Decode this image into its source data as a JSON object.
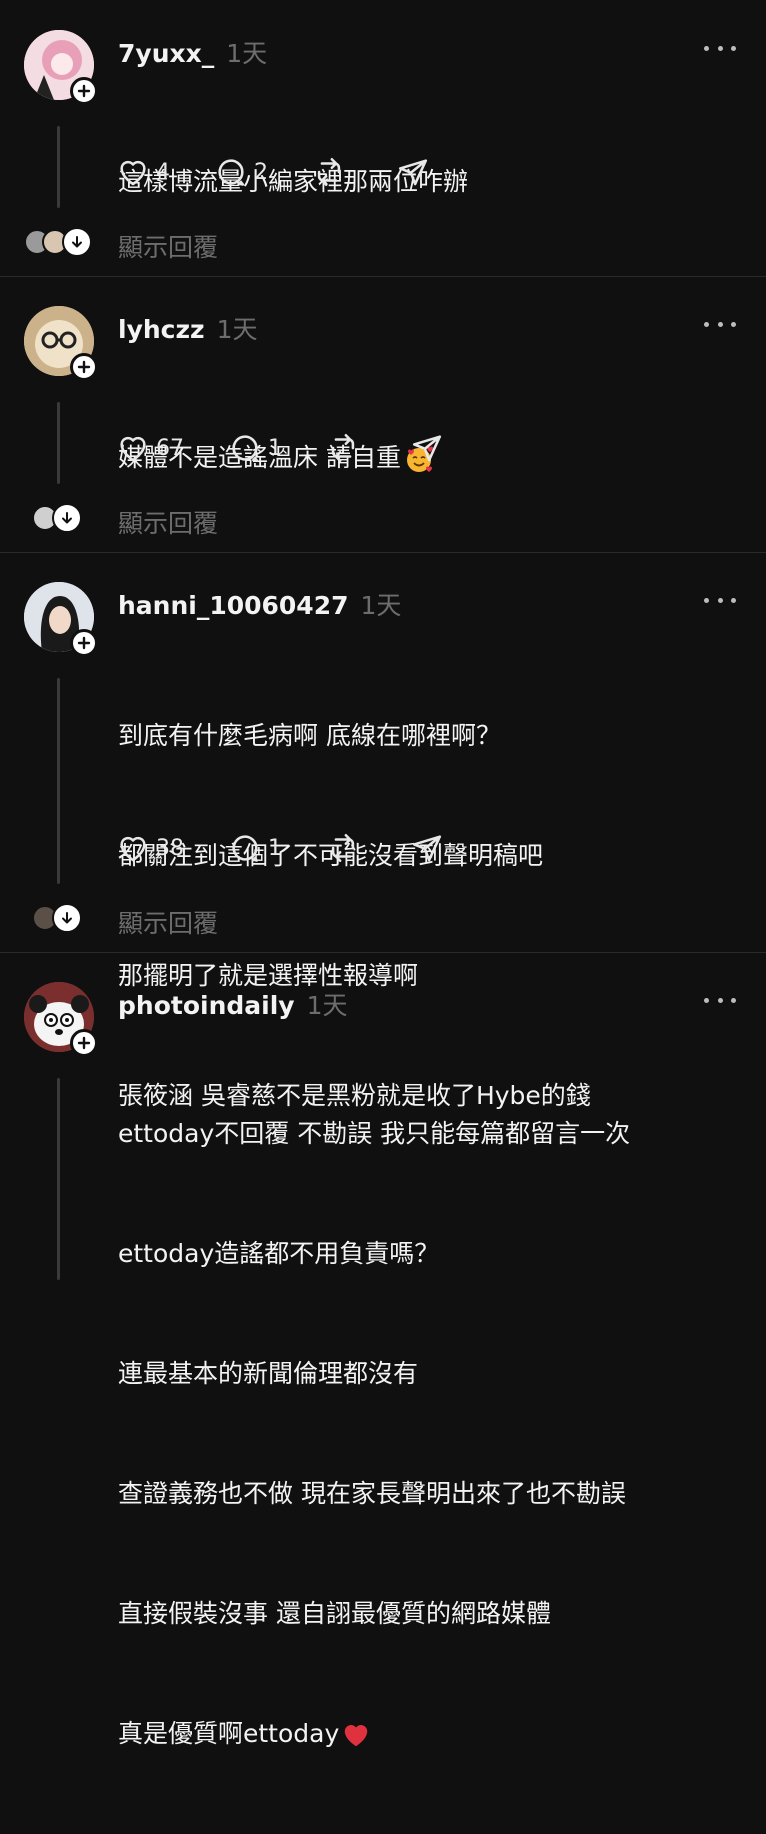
{
  "posts": [
    {
      "username": "7yuxx_",
      "time": "1天",
      "lines": [
        "這樣博流量小編家裡那兩位咋辦"
      ],
      "likes": "4",
      "replies": "2",
      "show_replies": "顯示回覆"
    },
    {
      "username": "lyhczz",
      "time": "1天",
      "lines": [
        "媒體不是造謠溫床 請自重"
      ],
      "likes": "67",
      "replies": "1",
      "show_replies": "顯示回覆"
    },
    {
      "username": "hanni_10060427",
      "time": "1天",
      "lines": [
        "到底有什麼毛病啊 底線在哪裡啊？",
        "都關注到這個了不可能沒看到聲明稿吧",
        "那擺明了就是選擇性報導啊",
        "張筱涵 吳睿慈不是黑粉就是收了Hybe的錢"
      ],
      "likes": "38",
      "replies": "1",
      "show_replies": "顯示回覆"
    },
    {
      "username": "photoindaily",
      "time": "1天",
      "lines": [
        "ettoday不回覆 不勘誤 我只能每篇都留言一次",
        "ettoday造謠都不用負責嗎？",
        "連最基本的新聞倫理都沒有",
        "查證義務也不做 現在家長聲明出來了也不勘誤",
        "直接假裝沒事 還自詡最優質的網路媒體",
        "真是優質啊ettoday"
      ]
    }
  ],
  "icons": {
    "like": "heart-icon",
    "reply": "comment-bubble-icon",
    "repost": "repost-icon",
    "share": "send-icon",
    "more": "more-dots-icon",
    "follow": "plus-icon",
    "expand": "arrow-down-icon"
  }
}
